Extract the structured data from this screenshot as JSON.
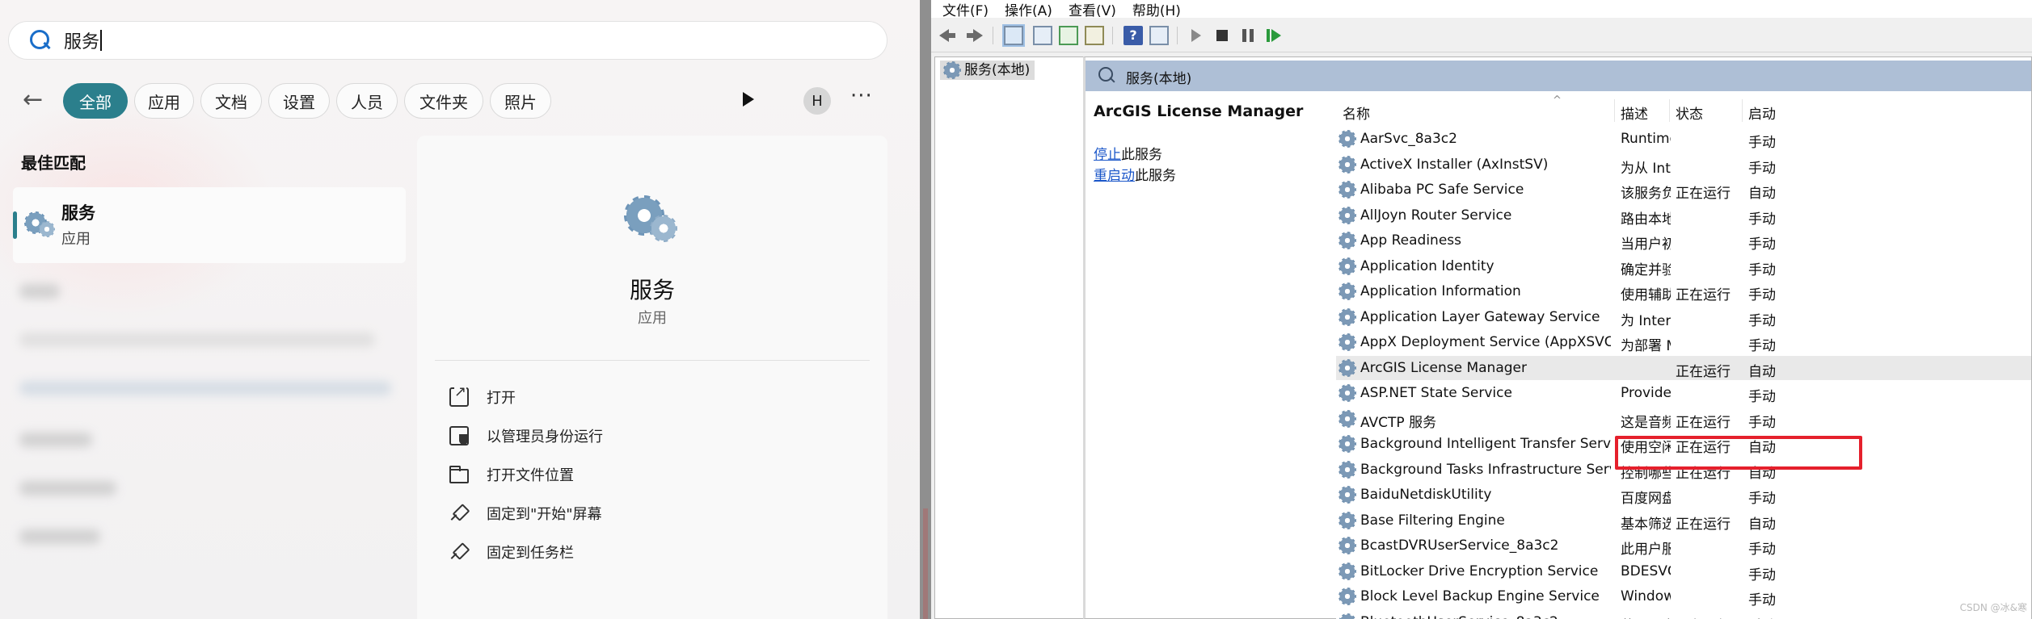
{
  "search": {
    "query": "服务"
  },
  "filters": [
    "全部",
    "应用",
    "文档",
    "设置",
    "人员",
    "文件夹",
    "照片"
  ],
  "profile_initial": "H",
  "more_label": "···",
  "best_match": {
    "heading": "最佳匹配",
    "name": "服务",
    "kind": "应用"
  },
  "detail": {
    "title": "服务",
    "subtitle": "应用",
    "actions": [
      "打开",
      "以管理员身份运行",
      "打开文件位置",
      "固定到\"开始\"屏幕",
      "固定到任务栏"
    ]
  },
  "mmc": {
    "menu": [
      "文件(F)",
      "操作(A)",
      "查看(V)",
      "帮助(H)"
    ],
    "tree_node": "服务(本地)",
    "header_label": "服务(本地)",
    "selected_service": "ArcGIS License Manager",
    "stop_link": "停止",
    "stop_suffix": "此服务",
    "restart_link": "重启动",
    "restart_suffix": "此服务",
    "columns": [
      "名称",
      "描述",
      "状态",
      "启动"
    ],
    "sort_indicator": "^",
    "rows": [
      {
        "name": "AarSvc_8a3c2",
        "desc": "Runtime f...",
        "status": "",
        "start": "手动"
      },
      {
        "name": "ActiveX Installer (AxInstSV)",
        "desc": "为从 Inter...",
        "status": "",
        "start": "手动"
      },
      {
        "name": "Alibaba PC Safe Service",
        "desc": "该服务负...",
        "status": "正在运行",
        "start": "自动"
      },
      {
        "name": "AllJoyn Router Service",
        "desc": "路由本地 ...",
        "status": "",
        "start": "手动"
      },
      {
        "name": "App Readiness",
        "desc": "当用户初...",
        "status": "",
        "start": "手动"
      },
      {
        "name": "Application Identity",
        "desc": "确定并验...",
        "status": "",
        "start": "手动"
      },
      {
        "name": "Application Information",
        "desc": "使用辅助...",
        "status": "正在运行",
        "start": "手动"
      },
      {
        "name": "Application Layer Gateway Service",
        "desc": "为 Interne...",
        "status": "",
        "start": "手动"
      },
      {
        "name": "AppX Deployment Service (AppXSVC)",
        "desc": "为部署 Mi...",
        "status": "",
        "start": "手动"
      },
      {
        "name": "ArcGIS License Manager",
        "desc": "",
        "status": "正在运行",
        "start": "自动"
      },
      {
        "name": "ASP.NET State Service",
        "desc": "Provides s...",
        "status": "",
        "start": "手动"
      },
      {
        "name": "AVCTP 服务",
        "desc": "这是音频...",
        "status": "正在运行",
        "start": "手动"
      },
      {
        "name": "Background Intelligent Transfer Service",
        "desc": "使用空闲...",
        "status": "正在运行",
        "start": "自动"
      },
      {
        "name": "Background Tasks Infrastructure Service",
        "desc": "控制哪些...",
        "status": "正在运行",
        "start": "自动"
      },
      {
        "name": "BaiduNetdiskUtility",
        "desc": "百度网盘...",
        "status": "",
        "start": "手动"
      },
      {
        "name": "Base Filtering Engine",
        "desc": "基本筛选...",
        "status": "正在运行",
        "start": "自动"
      },
      {
        "name": "BcastDVRUserService_8a3c2",
        "desc": "此用户服...",
        "status": "",
        "start": "手动"
      },
      {
        "name": "BitLocker Drive Encryption Service",
        "desc": "BDESVC ...",
        "status": "",
        "start": "手动"
      },
      {
        "name": "Block Level Backup Engine Service",
        "desc": "Windows ...",
        "status": "",
        "start": "手动"
      },
      {
        "name": "BluetoothUserService_8a3c2",
        "desc": "蓝牙用户...",
        "status": "正在运行",
        "start": "手动"
      }
    ],
    "watermark": "CSDN @冰&寒"
  }
}
